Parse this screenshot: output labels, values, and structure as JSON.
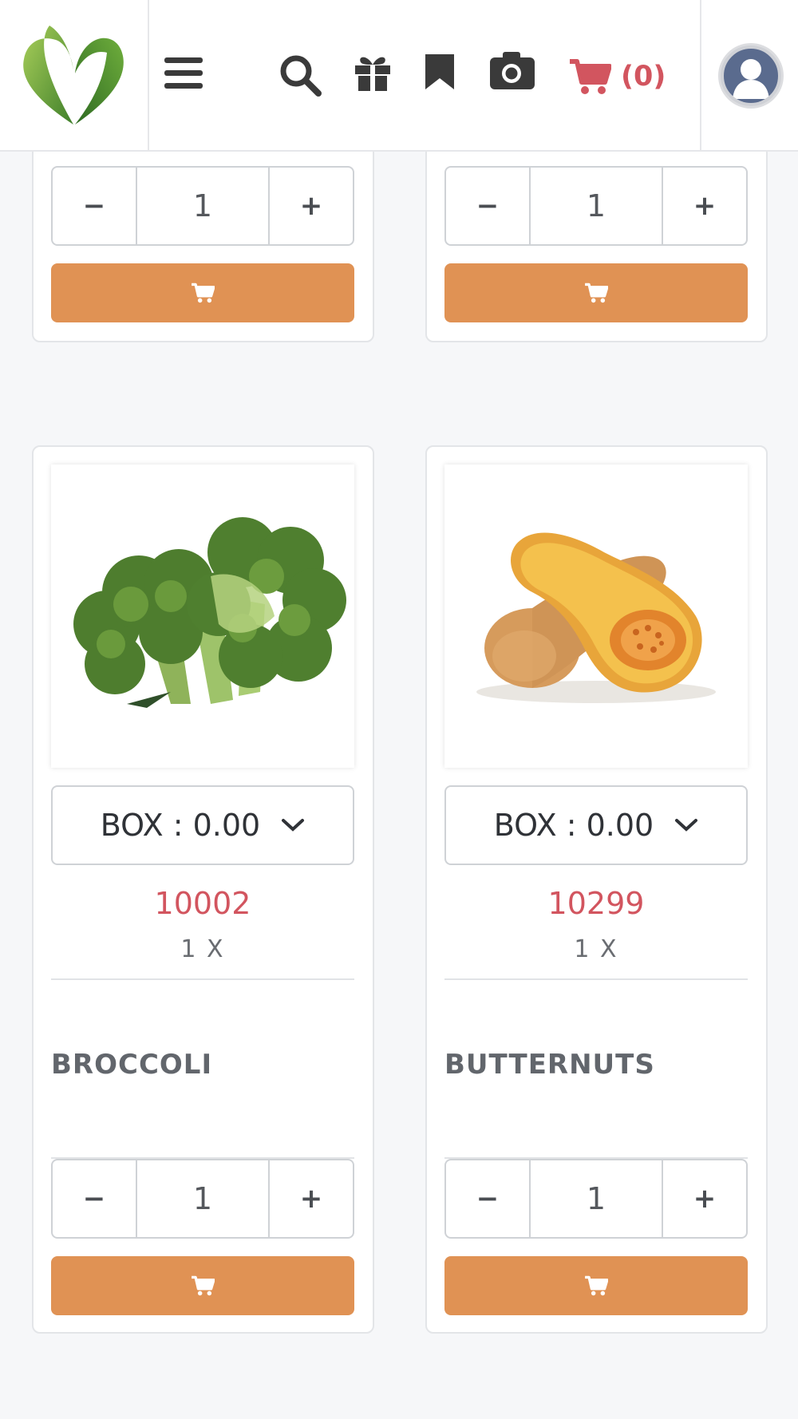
{
  "header": {
    "cart_count": "(0)",
    "brand_colors": {
      "accent": "#d2555f",
      "button": "#e09254",
      "logo_green": "#5a9a34"
    },
    "icons": [
      "logo-icon",
      "menu-icon",
      "search-icon",
      "gift-icon",
      "bookmark-icon",
      "camera-icon",
      "cart-icon",
      "user-avatar-icon"
    ]
  },
  "top_cards": [
    {
      "quantity": "1",
      "minus_label": "−",
      "plus_label": "+"
    },
    {
      "quantity": "1",
      "minus_label": "−",
      "plus_label": "+"
    }
  ],
  "products": [
    {
      "name": "BROCCOLI",
      "select_value": "BOX : 0.00",
      "code": "10002",
      "multiplier": "1 X",
      "quantity": "1",
      "minus_label": "−",
      "plus_label": "+"
    },
    {
      "name": "BUTTERNUTS",
      "select_value": "BOX : 0.00",
      "code": "10299",
      "multiplier": "1 X",
      "quantity": "1",
      "minus_label": "−",
      "plus_label": "+"
    }
  ]
}
